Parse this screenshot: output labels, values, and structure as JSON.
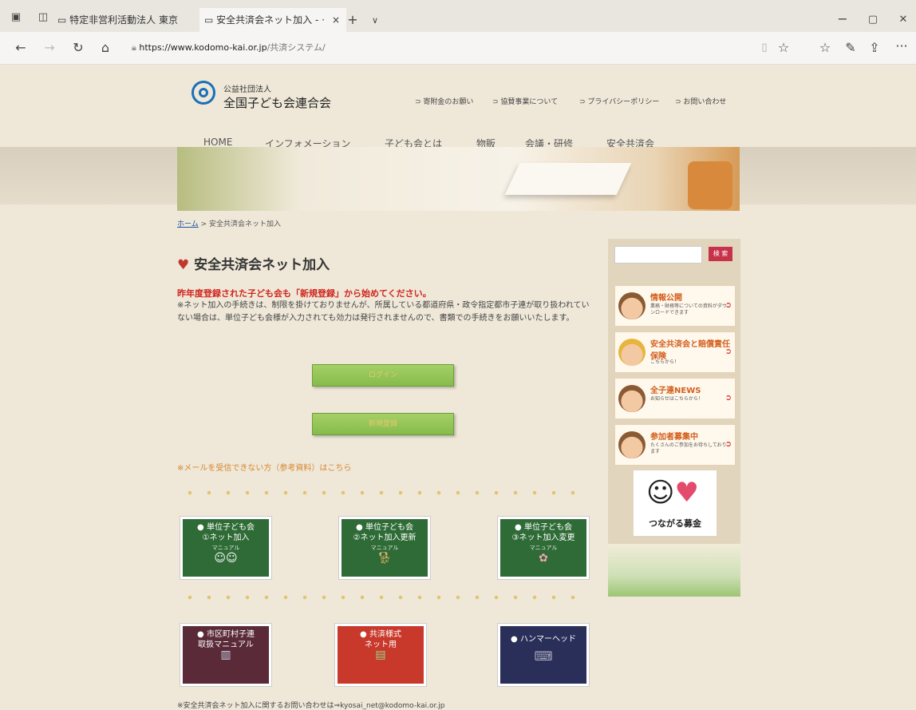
{
  "browser": {
    "tabs": [
      {
        "label": "特定非営利活動法人 東京"
      },
      {
        "label": "安全共済会ネット加入 - ·"
      }
    ],
    "tab_close": "×",
    "new_tab": "+",
    "tab_menu": "∨",
    "window_controls": {
      "minimize": "−",
      "maximize": "▢",
      "close": "✕"
    },
    "url_domain": "https://www.kodomo-kai.or.jp",
    "url_path": "/共済システム/",
    "more": "···"
  },
  "site": {
    "org_line1": "公益社団法人",
    "org_line2": "全国子ども会連合会",
    "top_links": [
      "寄附金のお願い",
      "協賛事業について",
      "プライバシーポリシー",
      "お問い合わせ"
    ],
    "nav": [
      "HOME",
      "インフォメーション",
      "子ども会とは",
      "物販",
      "会議・研修",
      "安全共済会"
    ]
  },
  "breadcrumb": {
    "home": "ホーム",
    "sep": " > ",
    "current": "安全共済会ネット加入"
  },
  "main": {
    "title": "安全共済会ネット加入",
    "notice_red": "昨年度登録された子ども会も「新規登録」から始めてください。",
    "notice_body": "※ネット加入の手続きは、制限を掛けておりませんが、所属している都道府県・政令指定都市子連が取り扱われていない場合は、単位子ども会様が入力されても効力は発行されませんので、書類での手続きをお願いいたします。",
    "login_btn": "ログイン",
    "register_btn": "新規登録",
    "mail_link": "※メールを受信できない方（参考資料）はこちら",
    "cards_row1": [
      {
        "l1": "単位子ども会",
        "l2": "①ネット加入",
        "l3": "マニュアル",
        "color": "#2f6b36"
      },
      {
        "l1": "単位子ども会",
        "l2": "②ネット加入更新",
        "l3": "マニュアル",
        "color": "#2f6b36"
      },
      {
        "l1": "単位子ども会",
        "l2": "③ネット加入変更",
        "l3": "マニュアル",
        "color": "#2f6b36"
      }
    ],
    "cards_row2": [
      {
        "l1": "市区町村子連",
        "l2": "取扱マニュアル",
        "color": "#5a2a38"
      },
      {
        "l1": "共済様式",
        "l2": "ネット用",
        "color": "#c8392b"
      },
      {
        "l1": "ハンマーヘッド",
        "l2": "",
        "color": "#2a2f5a"
      }
    ],
    "footer_note": "※安全共済会ネット加入に関するお問い合わせは⇒kyosai_net@kodomo-kai.or.jp"
  },
  "sidebar": {
    "search_btn": "検 索",
    "boxes": [
      {
        "title": "情報公開",
        "sub": "業務・財務等についての資料がダウンロードできます"
      },
      {
        "title": "安全共済会と賠償責任保険",
        "sub": "こちらから！"
      },
      {
        "title": "全子連NEWS",
        "sub": "お知らせはこちらから！"
      },
      {
        "title": "参加者募集中",
        "sub": "たくさんのご参加をお待ちしております"
      }
    ],
    "bokin": "つながる募金"
  }
}
